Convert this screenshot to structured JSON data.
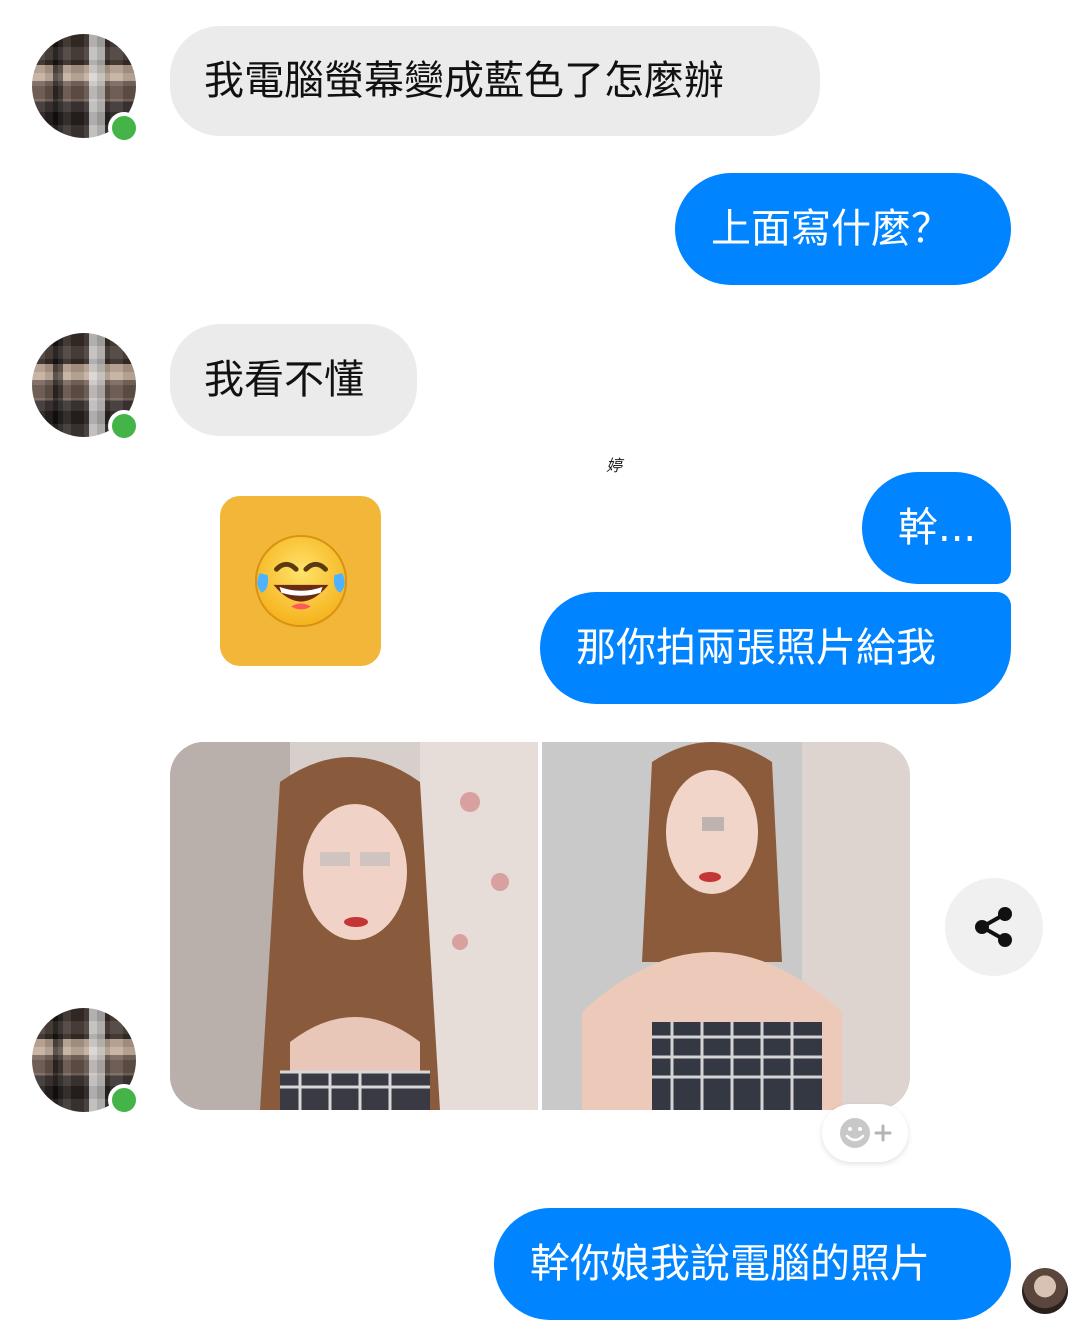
{
  "conversation": {
    "messages": [
      {
        "from": "contact",
        "text": "我電腦螢幕變成藍色了怎麼辦"
      },
      {
        "from": "me",
        "text": "上面寫什麼？"
      },
      {
        "from": "contact",
        "text": "我看不懂"
      },
      {
        "from": "contact",
        "type": "emoji",
        "emoji": "😂"
      },
      {
        "from": "me",
        "text": "幹..."
      },
      {
        "from": "me",
        "text": "那你拍兩張照片給我"
      },
      {
        "from": "contact",
        "type": "photos",
        "count": 2
      },
      {
        "from": "me",
        "text": "幹你娘我說電腦的照片"
      }
    ]
  },
  "watermark": "婷",
  "icons": {
    "share": "share-icon",
    "add_reaction": "add-reaction-icon"
  },
  "colors": {
    "outgoing_bubble": "#0084ff",
    "incoming_bubble": "#ebebeb",
    "online": "#44b449",
    "emoji_tile": "#f2b739"
  }
}
